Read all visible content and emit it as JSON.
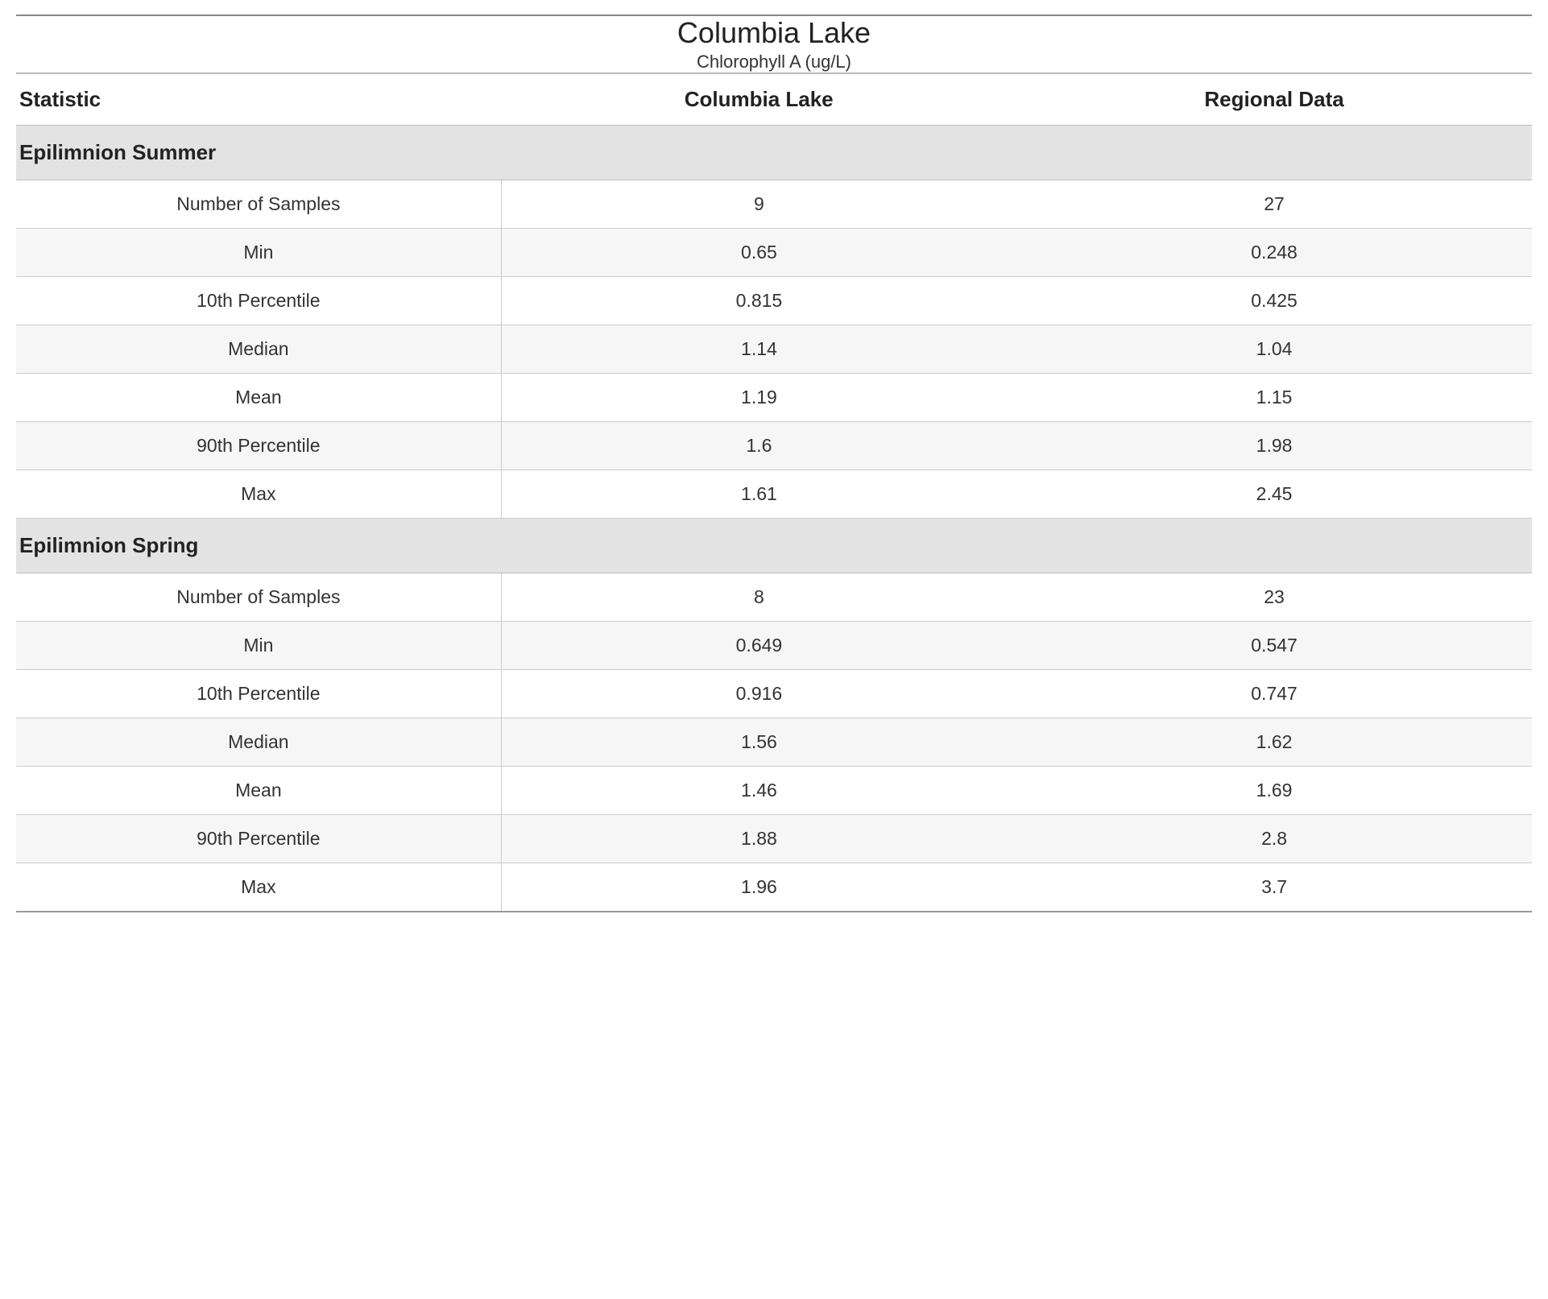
{
  "title": "Columbia Lake",
  "subtitle": "Chlorophyll A (ug/L)",
  "columns": [
    "Statistic",
    "Columbia Lake",
    "Regional Data"
  ],
  "sections": [
    {
      "name": "Epilimnion Summer",
      "rows": [
        {
          "stat": "Number of Samples",
          "lake": "9",
          "region": "27"
        },
        {
          "stat": "Min",
          "lake": "0.65",
          "region": "0.248"
        },
        {
          "stat": "10th Percentile",
          "lake": "0.815",
          "region": "0.425"
        },
        {
          "stat": "Median",
          "lake": "1.14",
          "region": "1.04"
        },
        {
          "stat": "Mean",
          "lake": "1.19",
          "region": "1.15"
        },
        {
          "stat": "90th Percentile",
          "lake": "1.6",
          "region": "1.98"
        },
        {
          "stat": "Max",
          "lake": "1.61",
          "region": "2.45"
        }
      ]
    },
    {
      "name": "Epilimnion Spring",
      "rows": [
        {
          "stat": "Number of Samples",
          "lake": "8",
          "region": "23"
        },
        {
          "stat": "Min",
          "lake": "0.649",
          "region": "0.547"
        },
        {
          "stat": "10th Percentile",
          "lake": "0.916",
          "region": "0.747"
        },
        {
          "stat": "Median",
          "lake": "1.56",
          "region": "1.62"
        },
        {
          "stat": "Mean",
          "lake": "1.46",
          "region": "1.69"
        },
        {
          "stat": "90th Percentile",
          "lake": "1.88",
          "region": "2.8"
        },
        {
          "stat": "Max",
          "lake": "1.96",
          "region": "3.7"
        }
      ]
    }
  ],
  "chart_data": {
    "type": "table",
    "title": "Columbia Lake — Chlorophyll A (ug/L)",
    "columns": [
      "Statistic",
      "Columbia Lake",
      "Regional Data"
    ],
    "groups": [
      {
        "name": "Epilimnion Summer",
        "rows": [
          [
            "Number of Samples",
            9,
            27
          ],
          [
            "Min",
            0.65,
            0.248
          ],
          [
            "10th Percentile",
            0.815,
            0.425
          ],
          [
            "Median",
            1.14,
            1.04
          ],
          [
            "Mean",
            1.19,
            1.15
          ],
          [
            "90th Percentile",
            1.6,
            1.98
          ],
          [
            "Max",
            1.61,
            2.45
          ]
        ]
      },
      {
        "name": "Epilimnion Spring",
        "rows": [
          [
            "Number of Samples",
            8,
            23
          ],
          [
            "Min",
            0.649,
            0.547
          ],
          [
            "10th Percentile",
            0.916,
            0.747
          ],
          [
            "Median",
            1.56,
            1.62
          ],
          [
            "Mean",
            1.46,
            1.69
          ],
          [
            "90th Percentile",
            1.88,
            2.8
          ],
          [
            "Max",
            1.96,
            3.7
          ]
        ]
      }
    ]
  }
}
